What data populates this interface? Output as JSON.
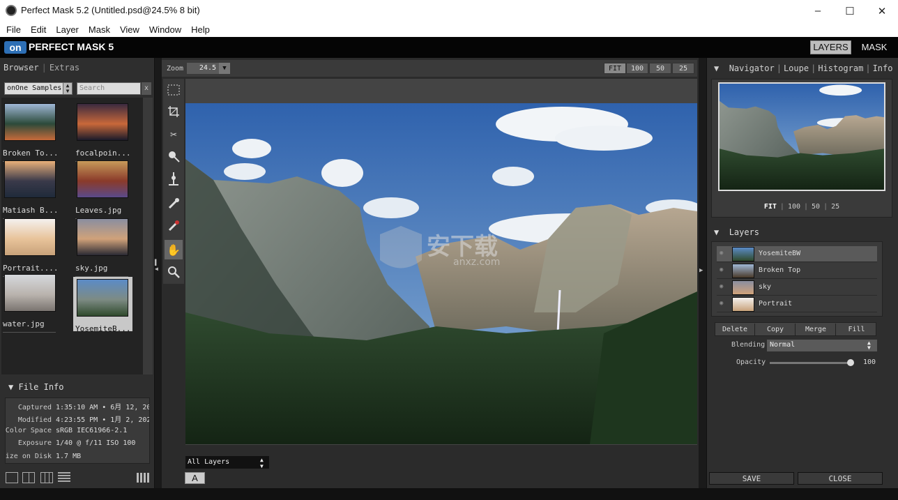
{
  "window": {
    "title": "Perfect Mask 5.2 (Untitled.psd@24.5% 8 bit)",
    "controls": [
      "–",
      "☐",
      "✕"
    ]
  },
  "menu": [
    "File",
    "Edit",
    "Layer",
    "Mask",
    "View",
    "Window",
    "Help"
  ],
  "app": {
    "logo_mark": "on",
    "logo_text": "PERFECT MASK 5",
    "modes": {
      "layers": "LAYERS",
      "mask": "MASK"
    }
  },
  "browser": {
    "tabs": {
      "browser": "Browser",
      "extras": "Extras"
    },
    "source": "onOne Samples",
    "search_placeholder": "Search",
    "search_clear": "x",
    "files": [
      {
        "label": "Broken To...",
        "colors": [
          "#9fb7d6",
          "#2c4a3a",
          "#c76a3a"
        ]
      },
      {
        "label": "focalpoin...",
        "colors": [
          "#3b2a3f",
          "#c8683a",
          "#1a1a2a"
        ]
      },
      {
        "label": "Matiash B...",
        "colors": [
          "#e9b07a",
          "#3a3a4a",
          "#1f2a3a"
        ]
      },
      {
        "label": "Leaves.jpg",
        "colors": [
          "#c79a5a",
          "#8a3a2a",
          "#5a4a8a"
        ]
      },
      {
        "label": "Portrait....",
        "colors": [
          "#f4f1ee",
          "#e8c39a",
          "#c8a27a"
        ]
      },
      {
        "label": "sky.jpg",
        "colors": [
          "#8a8ea0",
          "#d0a27a",
          "#2a2a33"
        ]
      },
      {
        "label": "water.jpg",
        "colors": [
          "#d6d8dc",
          "#b9b3ad",
          "#7a7470"
        ]
      },
      {
        "label": "YosemiteB...",
        "colors": [
          "#5b8bc6",
          "#7d8b84",
          "#2f4a2c"
        ]
      }
    ]
  },
  "file_info": {
    "title": "File Info",
    "rows": [
      {
        "label": "Captured",
        "value": "1:35:10 AM • 6月 12, 20"
      },
      {
        "label": "Modified",
        "value": "4:23:55 PM • 1月 2, 202"
      },
      {
        "label": "Color Space",
        "value": "sRGB IEC61966-2.1"
      },
      {
        "label": "Exposure",
        "value": "1/40 @ f/11  ISO 100"
      },
      {
        "label": "Size on Disk",
        "value": "1.7 MB"
      }
    ]
  },
  "canvas": {
    "zoom_label": "Zoom",
    "zoom_value": "24.5",
    "zoom_presets": [
      "FIT",
      "100",
      "50",
      "25"
    ],
    "layer_filter": "All Layers",
    "a_button": "A"
  },
  "tools": [
    "rect-select-icon",
    "crop-icon",
    "scissors-icon",
    "brush-plus-icon",
    "pin-icon",
    "dropper-icon",
    "dropper-remove-icon",
    "hand-icon",
    "zoom-icon"
  ],
  "navigator": {
    "tabs": [
      "Navigator",
      "Loupe",
      "Histogram",
      "Info"
    ],
    "zoom_presets": [
      "FIT",
      "100",
      "50",
      "25"
    ]
  },
  "layers": {
    "title": "Layers",
    "items": [
      {
        "name": "YosemiteBW",
        "selected": true,
        "colors": [
          "#5b8bc6",
          "#2f4a2c"
        ]
      },
      {
        "name": "Broken Top",
        "selected": false,
        "colors": [
          "#9fb7d6",
          "#4a3a2a"
        ]
      },
      {
        "name": "sky",
        "selected": false,
        "colors": [
          "#8a8ea0",
          "#d0a27a"
        ]
      },
      {
        "name": "Portrait",
        "selected": false,
        "colors": [
          "#f4f1ee",
          "#c8a27a"
        ]
      }
    ],
    "actions": [
      "Delete",
      "Copy",
      "Merge",
      "Fill"
    ],
    "blending_label": "Blending",
    "blending_value": "Normal",
    "opacity_label": "Opacity",
    "opacity_value": "100"
  },
  "footer": {
    "save": "SAVE",
    "close": "CLOSE"
  },
  "watermark": {
    "text": "安下载",
    "sub": "anxz.com"
  }
}
